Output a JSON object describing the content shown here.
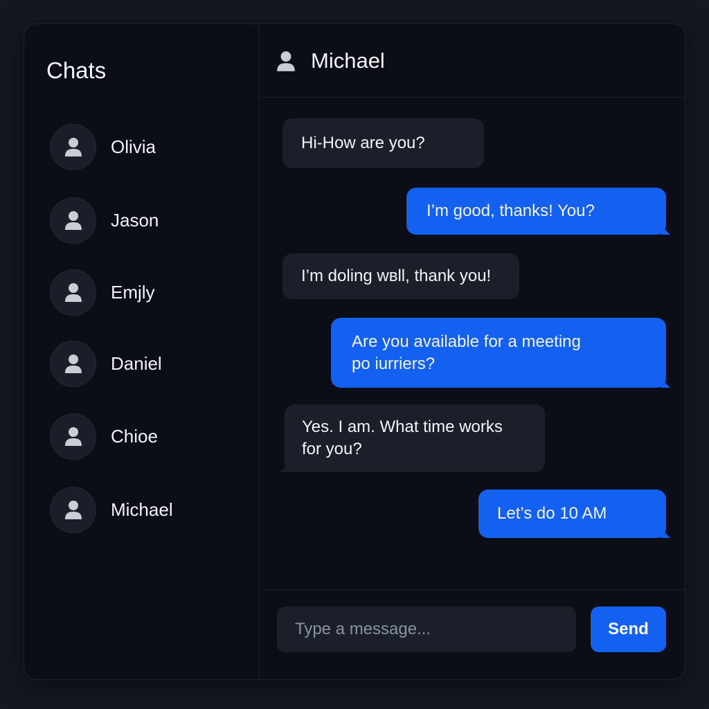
{
  "sidebar": {
    "title": "Chats",
    "contacts": [
      {
        "name": "Olivia"
      },
      {
        "name": "Jason"
      },
      {
        "name": "Emjly"
      },
      {
        "name": "Daniel"
      },
      {
        "name": "Chioe"
      },
      {
        "name": "Michael"
      }
    ]
  },
  "chat": {
    "contact_name": "Michael",
    "messages": [
      {
        "direction": "incoming",
        "text": "Hi-How are you?"
      },
      {
        "direction": "outgoing",
        "text": "I’m good, thanks! You?"
      },
      {
        "direction": "incoming",
        "text": "I’m doling wвll, thank you!"
      },
      {
        "direction": "outgoing",
        "line1": "Are you available for a meeting",
        "line2": "po iurriers?"
      },
      {
        "direction": "incoming",
        "line1": "Yes. I am. What time works",
        "line2": "for you?"
      },
      {
        "direction": "outgoing",
        "text": "Let’s do 10 AM"
      }
    ]
  },
  "composer": {
    "placeholder": "Type a message...",
    "send_label": "Send"
  },
  "icons": {
    "avatar": "user-icon"
  },
  "colors": {
    "background": "#141821",
    "window": "#0b0e17",
    "incoming_bubble": "#1b1f29",
    "outgoing_bubble": "#1460f0",
    "accent": "#1460f0"
  }
}
